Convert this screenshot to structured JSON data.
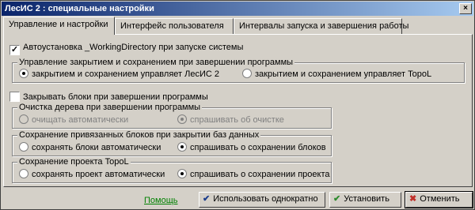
{
  "window": {
    "title": "ЛесИС 2 : специальные настройки",
    "close_glyph": "×"
  },
  "tabs": [
    {
      "label": "Управление и настройки",
      "active": true
    },
    {
      "label": "Интерфейс пользователя",
      "active": false
    },
    {
      "label": "Интервалы запуска и завершения работы",
      "active": false
    }
  ],
  "settings": {
    "autoinstall": {
      "label": "Автоустановка _WorkingDirectory при запуске системы",
      "checked": true
    },
    "close_control": {
      "title": "Управление закрытием и сохранением при завершении программы",
      "options": [
        {
          "label": "закрытием и сохранением управляет ЛесИС 2",
          "selected": true
        },
        {
          "label": "закрытием и сохранением управляет TopoL",
          "selected": false
        }
      ]
    },
    "close_blocks": {
      "label": "Закрывать блоки при завершении программы",
      "checked": false
    },
    "tree_cleanup": {
      "title": "Очистка дерева при завершении программы",
      "options": [
        {
          "label": "очищать автоматически",
          "selected": false,
          "disabled": true
        },
        {
          "label": "спрашивать об очистке",
          "selected": true,
          "disabled": true
        }
      ]
    },
    "linked_blocks": {
      "title": "Сохранение привязанных блоков при закрытии баз данных",
      "options": [
        {
          "label": "сохранять блоки автоматически",
          "selected": false
        },
        {
          "label": "спрашивать о сохранении блоков",
          "selected": true
        }
      ]
    },
    "topol_project": {
      "title": "Сохранение проекта TopoL",
      "options": [
        {
          "label": "сохранять проект автоматически",
          "selected": false
        },
        {
          "label": "спрашивать о сохранении проекта",
          "selected": true
        }
      ]
    }
  },
  "footer": {
    "help_label": "Помощь",
    "use_once_label": "Использовать однократно",
    "install_label": "Установить",
    "cancel_label": "Отменить",
    "checkmark_glyph": "✔",
    "cancel_glyph": "✖"
  },
  "colors": {
    "title_bar_start": "#0a246a",
    "title_bar_end": "#a6caf0",
    "help_link": "#008000",
    "use_once_icon": "#1b3c8c",
    "install_icon": "#2e8b2e",
    "cancel_icon": "#c0302a"
  }
}
